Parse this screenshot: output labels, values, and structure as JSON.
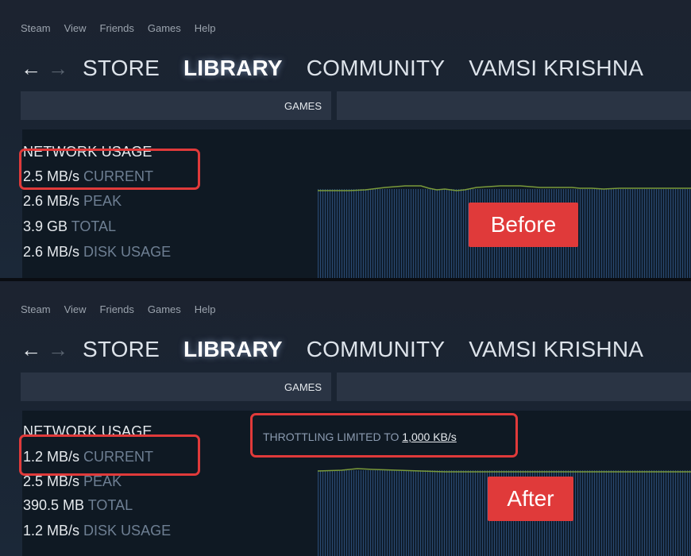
{
  "menu": [
    "Steam",
    "View",
    "Friends",
    "Games",
    "Help"
  ],
  "nav": {
    "back_icon": "left-arrow-icon",
    "forward_icon": "right-arrow-icon",
    "links": [
      "STORE",
      "LIBRARY",
      "COMMUNITY",
      "VAMSI KRISHNA"
    ],
    "active": "LIBRARY"
  },
  "subnav": {
    "games_label": "GAMES"
  },
  "before": {
    "title": "NETWORK USAGE",
    "current": {
      "value": "2.5 MB/s",
      "label": "CURRENT"
    },
    "peak": {
      "value": "2.6 MB/s",
      "label": "PEAK"
    },
    "total": {
      "value": "3.9 GB",
      "label": "TOTAL"
    },
    "disk": {
      "value": "2.6 MB/s",
      "label": "DISK USAGE"
    },
    "tag": "Before"
  },
  "after": {
    "title": "NETWORK USAGE",
    "current": {
      "value": "1.2 MB/s",
      "label": "CURRENT"
    },
    "peak": {
      "value": "2.5 MB/s",
      "label": "PEAK"
    },
    "total": {
      "value": "390.5 MB",
      "label": "TOTAL"
    },
    "disk": {
      "value": "1.2 MB/s",
      "label": "DISK USAGE"
    },
    "throttle_prefix": "THROTTLING LIMITED TO",
    "throttle_value": "1,000 KB/s",
    "tag": "After"
  },
  "colors": {
    "highlight": "#e03a3a",
    "graph_bar": "#2a4a72",
    "graph_line": "#7a9a3a",
    "background": "#1b2838"
  }
}
